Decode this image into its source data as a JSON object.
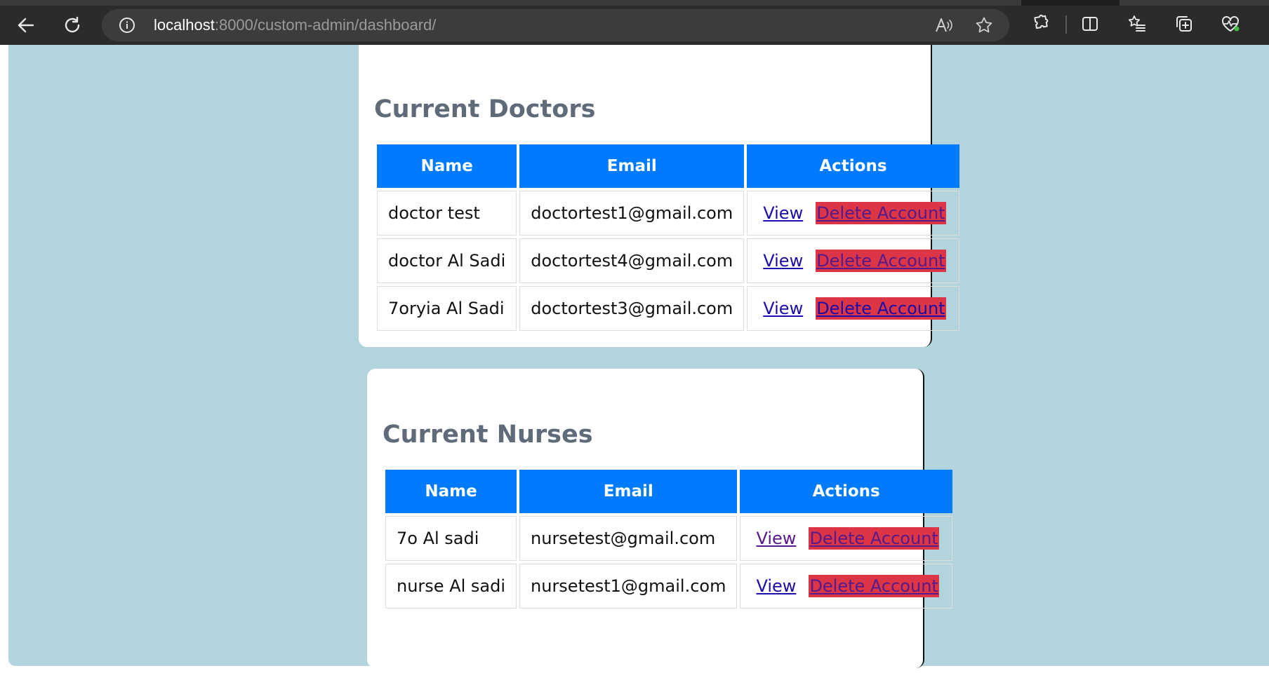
{
  "browser": {
    "url_host": "localhost",
    "url_path": ":8000/custom-admin/dashboard/",
    "icons": {
      "back": "back-arrow-icon",
      "refresh": "refresh-icon",
      "site_info": "info-icon",
      "read_aloud": "read-aloud-icon",
      "favorite": "star-icon",
      "extensions": "puzzle-icon",
      "split_screen": "split-screen-icon",
      "favorites": "favorites-list-icon",
      "collections": "collections-icon",
      "health": "browser-essentials-icon"
    }
  },
  "doctors": {
    "title": "Current Doctors",
    "headers": [
      "Name",
      "Email",
      "Actions"
    ],
    "rows": [
      {
        "name": "doctor test",
        "email": "doctortest1@gmail.com",
        "view": "View",
        "delete": "Delete Account"
      },
      {
        "name": "doctor Al Sadi",
        "email": "doctortest4@gmail.com",
        "view": "View",
        "delete": "Delete Account"
      },
      {
        "name": "7oryia Al Sadi",
        "email": "doctortest3@gmail.com",
        "view": "View",
        "delete": "Delete Account"
      }
    ]
  },
  "nurses": {
    "title": "Current Nurses",
    "headers": [
      "Name",
      "Email",
      "Actions"
    ],
    "rows": [
      {
        "name": "7o Al sadi",
        "email": "nursetest@gmail.com",
        "view": "View",
        "delete": "Delete Account"
      },
      {
        "name": "nurse Al sadi",
        "email": "nursetest1@gmail.com",
        "view": "View",
        "delete": "Delete Account"
      }
    ]
  },
  "colors": {
    "page_background": "#b2d5dd",
    "header_blue": "#007bff",
    "delete_red": "#dc3545",
    "title_gray": "#5f6b78"
  }
}
